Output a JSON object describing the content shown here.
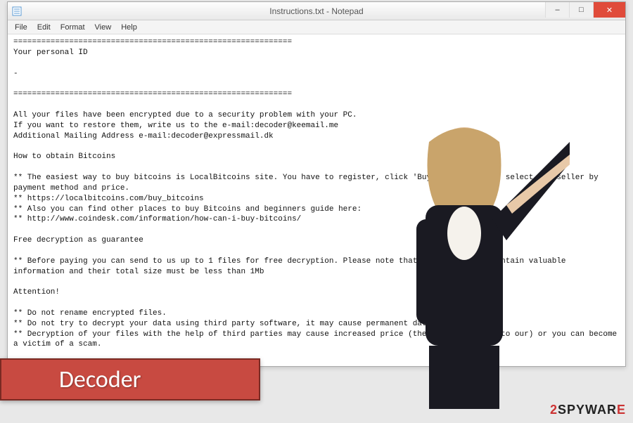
{
  "window": {
    "title": "Instructions.txt - Notepad",
    "icon": "notepad-icon"
  },
  "menu": {
    "items": [
      "File",
      "Edit",
      "Format",
      "View",
      "Help"
    ]
  },
  "content": {
    "text": "============================================================\nYour personal ID\n\n-\n\n============================================================\n\nAll your files have been encrypted due to a security problem with your PC.\nIf you want to restore them, write us to the e-mail:decoder@keemail.me\nAdditional Mailing Address e-mail:decoder@expressmail.dk\n\nHow to obtain Bitcoins\n\n** The easiest way to buy bitcoins is LocalBitcoins site. You have to register, click 'Buy bitcoins', and select the seller by payment method and price.\n** https://localbitcoins.com/buy_bitcoins\n** Also you can find other places to buy Bitcoins and beginners guide here:\n** http://www.coindesk.com/information/how-can-i-buy-bitcoins/\n\nFree decryption as guarantee\n\n** Before paying you can send to us up to 1 files for free decryption. Please note that files must NOT contain valuable information and their total size must be less than 1Mb\n\nAttention!\n\n** Do not rename encrypted files.\n** Do not try to decrypt your data using third party software, it may cause permanent data loss.\n** Decryption of your files with the help of third parties may cause increased price (they add their fee to our) or you can become a victim of a scam."
  },
  "banner": {
    "label": "Decoder"
  },
  "watermark": {
    "prefix": "2",
    "mid": "SPYWAR",
    "suffix": "E"
  },
  "controls": {
    "minimize": "–",
    "maximize": "□",
    "close": "✕"
  }
}
